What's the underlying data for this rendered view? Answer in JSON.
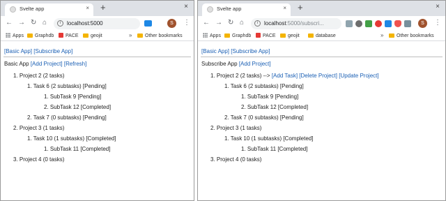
{
  "browser": {
    "tab_title": "Svelte app",
    "tab_close": "×",
    "new_tab": "+",
    "window_close": "×",
    "url_left": "localhost:5000",
    "url_right_host": "localhost",
    "url_right_rest": ":5000/subscri...",
    "profile_initial": "S",
    "bookmarks_left": [
      "Apps",
      "Graphdb",
      "PACE",
      "geojit"
    ],
    "bookmarks_right": [
      "Apps",
      "Graphdb",
      "PACE",
      "geojit",
      "database"
    ],
    "bookmarks_more": "»",
    "other_bookmarks": "Other bookmarks"
  },
  "nav": {
    "basic_app": "[Basic App]",
    "subscribe_app": "[Subscribe App]"
  },
  "left": {
    "app_title": "Basic App",
    "add_project": "[Add Project]",
    "refresh": "[Refresh]",
    "rows": [
      "1. Project 2 (2 tasks)",
      "1. Task 6 (2 subtasks) [Pending]",
      "1. SubTask 9 [Pending]",
      "2. SubTask 12 [Completed]",
      "2. Task 7 (0 subtasks) [Pending]",
      "2. Project 3 (1 tasks)",
      "1. Task 10 (1 subtasks) [Completed]",
      "1. SubTask 11 [Completed]",
      "3. Project 4 (0 tasks)"
    ]
  },
  "right": {
    "app_title": "Subscribe App",
    "add_project": "[Add Project]",
    "project2_prefix": "1. Project 2 (2 tasks) -->",
    "add_task": "[Add Task]",
    "delete_project": "[Delete Project]",
    "update_project": "[Update Project]",
    "rows": [
      "1. Task 6 (2 subtasks) [Pending]",
      "1. SubTask 9 [Pending]",
      "2. SubTask 12 [Completed]",
      "2. Task 7 (0 subtasks) [Pending]",
      "2. Project 3 (1 tasks)",
      "1. Task 10 (1 subtasks) [Completed]",
      "1. SubTask 11 [Completed]",
      "3. Project 4 (0 tasks)"
    ]
  },
  "colors": {
    "link": "#1a5fb4",
    "tabstrip": "#dee1e6",
    "profile": "#a0522d"
  }
}
